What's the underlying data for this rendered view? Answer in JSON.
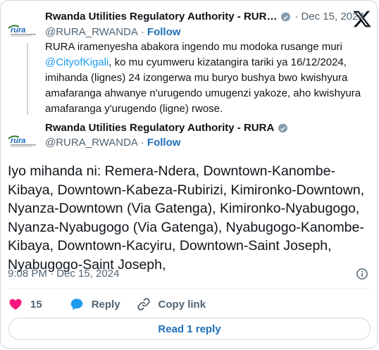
{
  "reply_tweet": {
    "display_name": "Rwanda Utilities Regulatory Authority - RUR…",
    "date": "Dec 15, 2024",
    "separator": "·",
    "handle": "@RURA_RWANDA",
    "follow_label": "Follow",
    "text_part1": "RURA iramenyesha abakora ingendo mu modoka rusange muri ",
    "mention": "@CityofKigali",
    "text_part2": ", ko mu cyumweru kizatangira tariki ya  16/12/2024, imihanda (lignes) 24 izongerwa mu buryo bushya bwo kwishyura amafaranga ahwanye n'urugendo umugenzi yakoze, aho kwishyura amafaranga y'urugendo (ligne) rwose."
  },
  "main_tweet": {
    "display_name": "Rwanda Utilities Regulatory Authority - RURA",
    "handle": "@RURA_RWANDA",
    "separator": "·",
    "follow_label": "Follow",
    "text": "Iyo mihanda ni: Remera-Ndera, Downtown-Kanombe-Kibaya, Downtown-Kabeza-Rubirizi, Kimironko-Downtown, Nyanza-Downtown (Via Gatenga), Kimironko-Nyabugogo, Nyanza-Nyabugogo (Via Gatenga), Nyabugogo-Kanombe-Kibaya, Downtown-Kacyiru, Downtown-Saint Joseph, Nyabugogo-Saint Joseph,",
    "timestamp": "9:08 PM · Dec 15, 2024"
  },
  "actions": {
    "like_count": "15",
    "reply_label": "Reply",
    "copy_link_label": "Copy link"
  },
  "read_replies_label": "Read 1 reply",
  "logo_text": "rura",
  "icons": {
    "brand": "x-logo-icon",
    "verified": "verified-badge-icon",
    "info": "info-icon",
    "like": "heart-icon",
    "reply": "speech-bubble-icon",
    "copy": "link-icon"
  },
  "colors": {
    "link": "#1d9bf0",
    "follow": "#1d6fb8",
    "heart": "#f91880",
    "reply_bubble": "#1d9bf0",
    "muted": "#536471"
  }
}
